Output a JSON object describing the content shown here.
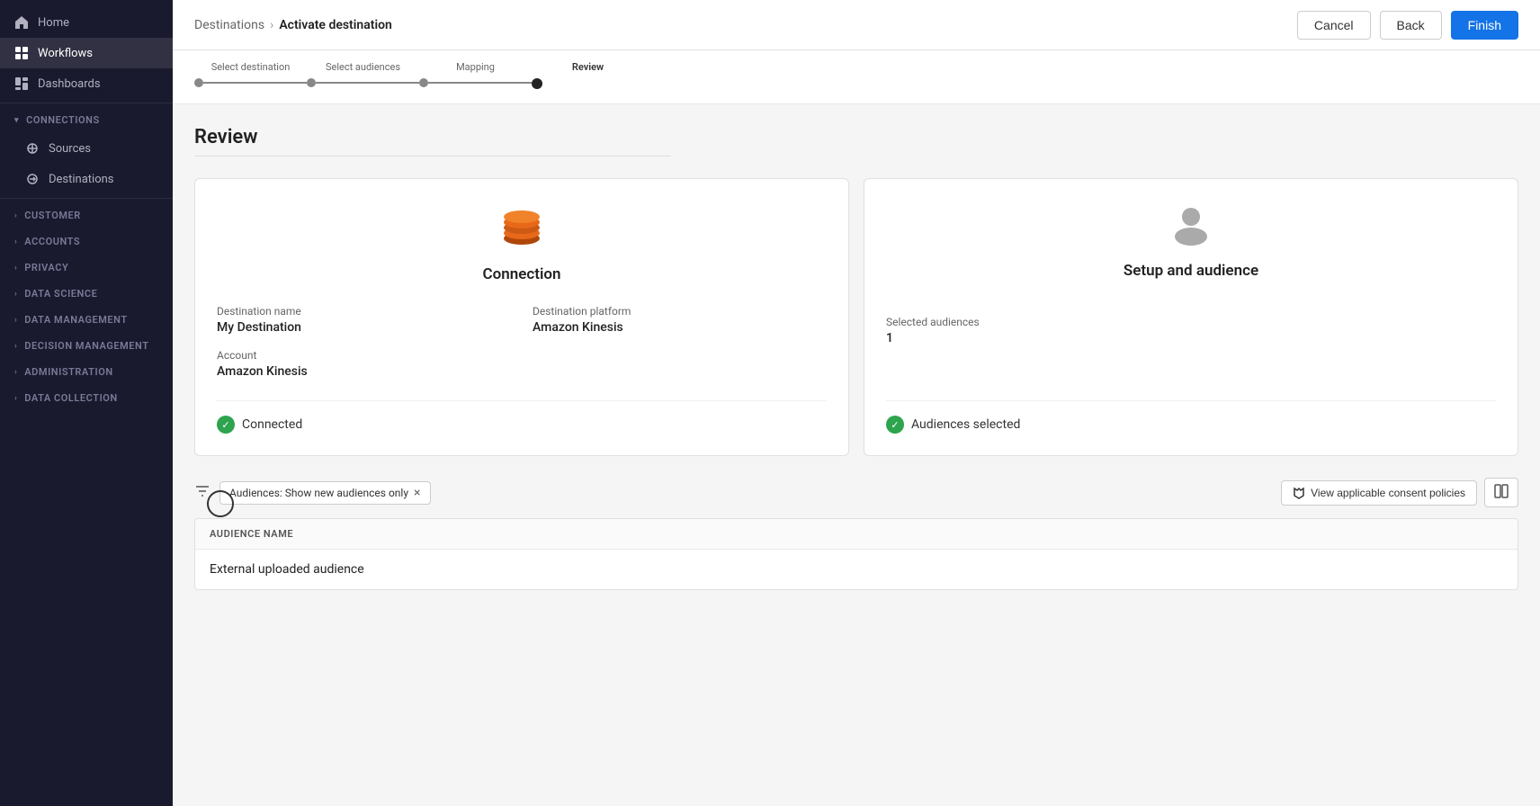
{
  "sidebar": {
    "items": [
      {
        "id": "home",
        "label": "Home",
        "icon": "home",
        "active": false
      },
      {
        "id": "workflows",
        "label": "Workflows",
        "icon": "workflows",
        "active": true
      },
      {
        "id": "dashboards",
        "label": "Dashboards",
        "icon": "dashboards",
        "active": false
      }
    ],
    "sections": [
      {
        "id": "connections",
        "label": "CONNECTIONS",
        "expanded": true,
        "children": [
          {
            "id": "sources",
            "label": "Sources",
            "active": false
          },
          {
            "id": "destinations",
            "label": "Destinations",
            "active": false
          }
        ]
      },
      {
        "id": "customer",
        "label": "CUSTOMER",
        "expanded": false,
        "children": []
      },
      {
        "id": "accounts",
        "label": "ACCOUNTS",
        "expanded": false,
        "children": []
      },
      {
        "id": "privacy",
        "label": "PRIVACY",
        "expanded": false,
        "children": []
      },
      {
        "id": "data-science",
        "label": "DATA SCIENCE",
        "expanded": false,
        "children": []
      },
      {
        "id": "data-management",
        "label": "DATA MANAGEMENT",
        "expanded": false,
        "children": []
      },
      {
        "id": "decision-management",
        "label": "DECISION MANAGEMENT",
        "expanded": false,
        "children": []
      },
      {
        "id": "administration",
        "label": "ADMINISTRATION",
        "expanded": false,
        "children": []
      },
      {
        "id": "data-collection",
        "label": "DATA COLLECTION",
        "expanded": false,
        "children": []
      }
    ]
  },
  "topbar": {
    "breadcrumb_parent": "Destinations",
    "breadcrumb_separator": "›",
    "breadcrumb_current": "Activate destination",
    "cancel_label": "Cancel",
    "back_label": "Back",
    "finish_label": "Finish"
  },
  "stepper": {
    "steps": [
      {
        "id": "select-destination",
        "label": "Select destination",
        "state": "completed"
      },
      {
        "id": "select-audiences",
        "label": "Select audiences",
        "state": "completed"
      },
      {
        "id": "mapping",
        "label": "Mapping",
        "state": "completed"
      },
      {
        "id": "review",
        "label": "Review",
        "state": "active"
      }
    ]
  },
  "review": {
    "title": "Review",
    "connection_card": {
      "title": "Connection",
      "destination_name_label": "Destination name",
      "destination_name_value": "My Destination",
      "destination_platform_label": "Destination platform",
      "destination_platform_value": "Amazon Kinesis",
      "account_label": "Account",
      "account_value": "Amazon Kinesis",
      "status_label": "Connected"
    },
    "setup_card": {
      "title": "Setup and audience",
      "selected_audiences_label": "Selected audiences",
      "selected_audiences_value": "1",
      "status_label": "Audiences selected"
    }
  },
  "filter": {
    "filter_tag_text": "Audiences: Show new audiences only",
    "filter_tag_remove": "×",
    "consent_btn_label": "View applicable consent policies",
    "columns_icon": "⊞"
  },
  "table": {
    "column_header": "AUDIENCE NAME",
    "rows": [
      {
        "audience_name": "External uploaded audience"
      }
    ]
  }
}
